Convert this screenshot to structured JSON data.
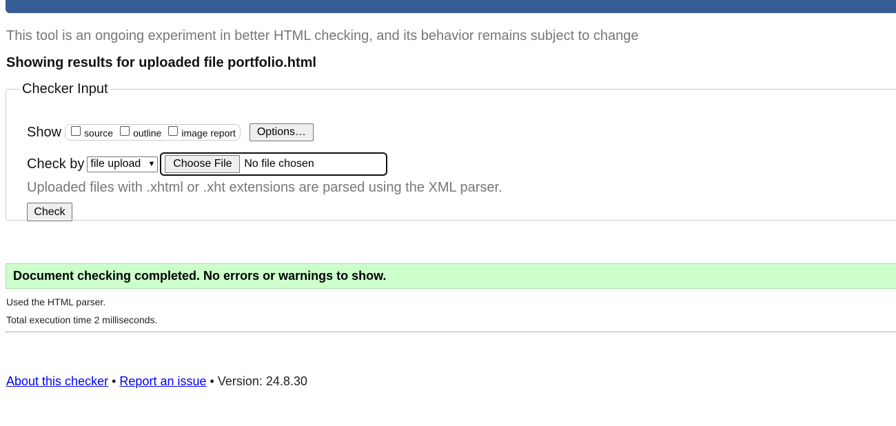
{
  "intro": "This tool is an ongoing experiment in better HTML checking, and its behavior remains subject to change",
  "results_heading": "Showing results for uploaded file portfolio.html",
  "checker": {
    "legend": "Checker Input",
    "show_label": "Show",
    "show_options": [
      "source",
      "outline",
      "image report"
    ],
    "options_button": "Options…",
    "check_by_label": "Check by",
    "check_by_value": "file upload",
    "choose_file_button": "Choose File",
    "file_status": "No file chosen",
    "note": "Uploaded files with .xhtml or .xht extensions are parsed using the XML parser.",
    "check_button": "Check"
  },
  "result": {
    "message": "Document checking completed. No errors or warnings to show.",
    "parser": "Used the HTML parser.",
    "time": "Total execution time 2 milliseconds."
  },
  "footer": {
    "about": "About this checker",
    "separator": "•",
    "report": "Report an issue",
    "version": "Version: 24.8.30"
  },
  "colors": {
    "topbar": "#365d95",
    "success_bg": "#ccffcc",
    "link": "#0000ee"
  }
}
